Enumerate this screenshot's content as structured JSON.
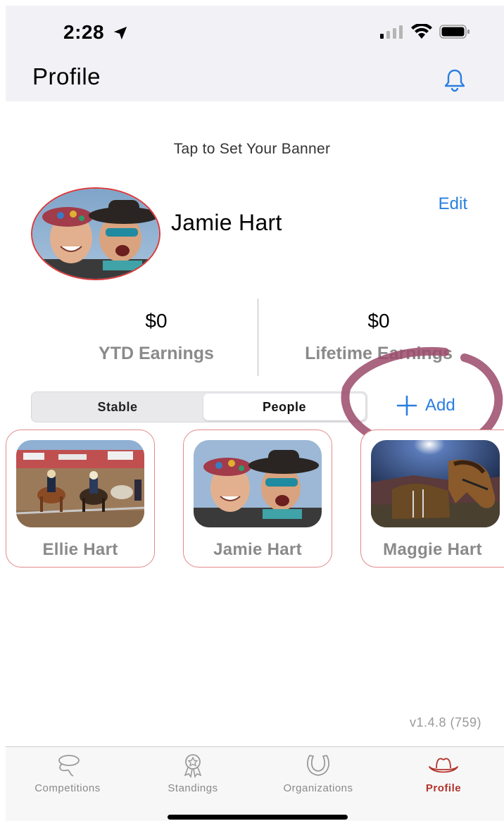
{
  "status_bar": {
    "time": "2:28"
  },
  "nav": {
    "title": "Profile"
  },
  "banner": {
    "hint": "Tap to Set Your Banner"
  },
  "profile": {
    "name": "Jamie Hart",
    "edit_label": "Edit"
  },
  "stats": [
    {
      "value": "$0",
      "label": "YTD Earnings"
    },
    {
      "value": "$0",
      "label": "Lifetime Earnings"
    }
  ],
  "segments": {
    "stable": "Stable",
    "people": "People",
    "selected": "People"
  },
  "add_label": "Add",
  "people": [
    {
      "name": "Ellie Hart"
    },
    {
      "name": "Jamie Hart"
    },
    {
      "name": "Maggie Hart"
    }
  ],
  "version": "v1.4.8 (759)",
  "tabs": [
    {
      "label": "Competitions",
      "icon": "lasso-icon"
    },
    {
      "label": "Standings",
      "icon": "award-ribbon-icon"
    },
    {
      "label": "Organizations",
      "icon": "horseshoe-icon"
    },
    {
      "label": "Profile",
      "icon": "cowboy-hat-icon"
    }
  ],
  "colors": {
    "accent_blue": "#2a7ee0",
    "active_tab": "#b3322c",
    "card_border": "#e28a8a",
    "annotation": "#9b4a6a"
  }
}
